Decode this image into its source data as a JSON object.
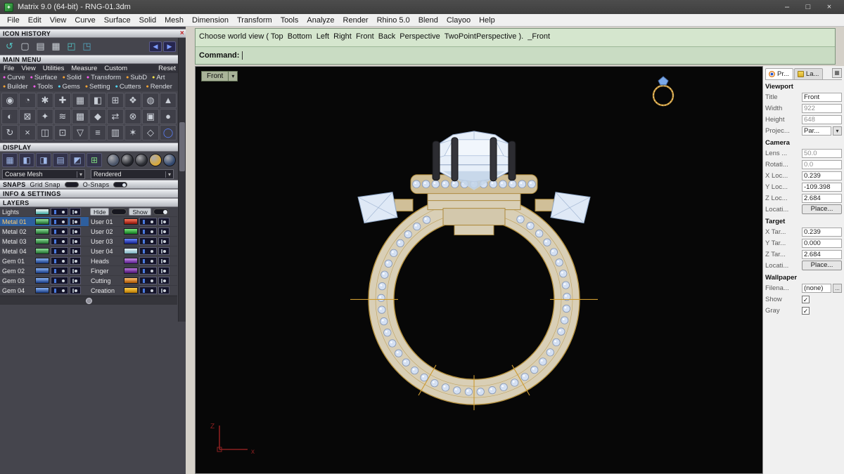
{
  "window": {
    "title": "Matrix 9.0 (64-bit) - RNG-01.3dm",
    "controls": {
      "minimize": "–",
      "maximize": "□",
      "close": "×"
    }
  },
  "icons": {
    "close_x": "×",
    "dropdown": "▾",
    "back": "◀",
    "forward": "▶",
    "check": "✓",
    "pin": "▦",
    "app": "✦"
  },
  "menubar": {
    "items": [
      "File",
      "Edit",
      "View",
      "Curve",
      "Surface",
      "Solid",
      "Mesh",
      "Dimension",
      "Transform",
      "Tools",
      "Analyze",
      "Render",
      "Rhino 5.0",
      "Blend",
      "Clayoo",
      "Help"
    ]
  },
  "command_area": {
    "history": "Choose world view ( Top  Bottom  Left  Right  Front  Back  Perspective  TwoPointPerspective ).  _Front",
    "prompt_label": "Command:"
  },
  "left_panel": {
    "icon_history": {
      "title": "ICON HISTORY",
      "icons": [
        {
          "n": "undo-history",
          "g": "↺",
          "c": "#53c2c2"
        },
        {
          "n": "new-file",
          "g": "▢"
        },
        {
          "n": "notes",
          "g": "▤"
        },
        {
          "n": "table",
          "g": "▦"
        },
        {
          "n": "open-folder",
          "g": "◰",
          "c": "#53c2c2"
        },
        {
          "n": "export",
          "g": "◳",
          "c": "#53a8c2"
        }
      ]
    },
    "main_menu": {
      "title": "MAIN MENU",
      "items": [
        "File",
        "View",
        "Utilities",
        "Measure",
        "Custom"
      ],
      "reset_label": "Reset",
      "categories_row1": [
        {
          "label": "Curve",
          "color": "#ff5ef2"
        },
        {
          "label": "Surface",
          "color": "#ff5ef2"
        },
        {
          "label": "Solid",
          "color": "#ffa733"
        },
        {
          "label": "Transform",
          "color": "#ff5ef2"
        },
        {
          "label": "SubD",
          "color": "#ffa733"
        },
        {
          "label": "Art",
          "color": "#ffe94a"
        }
      ],
      "categories_row2": [
        {
          "label": "Builder",
          "color": "#ffa733"
        },
        {
          "label": "Tools",
          "color": "#ff5ef2"
        },
        {
          "label": "Gems",
          "color": "#52dcff"
        },
        {
          "label": "Setting",
          "color": "#ffa733"
        },
        {
          "label": "Cutters",
          "color": "#52dcff"
        },
        {
          "label": "Render",
          "color": "#ffa733"
        }
      ]
    },
    "toolbar_rows": [
      [
        {
          "n": "pointer",
          "g": "◉"
        },
        {
          "n": "history",
          "g": "◔"
        },
        {
          "n": "points",
          "g": "✱"
        },
        {
          "n": "move",
          "g": "✚"
        },
        {
          "n": "grid",
          "g": "▦"
        },
        {
          "n": "split",
          "g": "◧"
        },
        {
          "n": "array",
          "g": "⊞"
        },
        {
          "n": "gem-tool",
          "g": "❖"
        },
        {
          "n": "sphere",
          "g": "◍"
        },
        {
          "n": "mesh",
          "g": "▲"
        }
      ],
      [
        {
          "n": "shade",
          "g": "◐"
        },
        {
          "n": "delete",
          "g": "⊠"
        },
        {
          "n": "sparkle",
          "g": "✦"
        },
        {
          "n": "waves",
          "g": "≋"
        },
        {
          "n": "hatch",
          "g": "▩"
        },
        {
          "n": "diamond",
          "g": "◆"
        },
        {
          "n": "swap",
          "g": "⇄"
        },
        {
          "n": "boolean",
          "g": "⊗"
        },
        {
          "n": "box",
          "g": "▣"
        },
        {
          "n": "dot",
          "g": "●"
        }
      ],
      [
        {
          "n": "rotate",
          "g": "↻"
        },
        {
          "n": "erase",
          "g": "×"
        },
        {
          "n": "panels",
          "g": "◫"
        },
        {
          "n": "center",
          "g": "⊡"
        },
        {
          "n": "taper",
          "g": "▽"
        },
        {
          "n": "layers-tool",
          "g": "≡"
        },
        {
          "n": "rows",
          "g": "▥"
        },
        {
          "n": "star",
          "g": "✶"
        },
        {
          "n": "gem",
          "g": "◇"
        },
        {
          "n": "ring-tool",
          "g": "◯",
          "c": "#5a7cf0"
        }
      ]
    ],
    "display": {
      "title": "DISPLAY",
      "icons": [
        {
          "n": "wire",
          "g": "▦"
        },
        {
          "n": "half-left",
          "g": "◧"
        },
        {
          "n": "half-right",
          "g": "◨"
        },
        {
          "n": "lines",
          "g": "▤"
        },
        {
          "n": "corner",
          "g": "◩"
        },
        {
          "n": "plus",
          "g": "⊞",
          "c": "#7ed87e"
        }
      ],
      "spheres": [
        "#4a5468",
        "#23252b",
        "#2b2d33",
        "#d8a93c",
        "#32486e"
      ],
      "mesh_dropdown": "Coarse Mesh",
      "render_dropdown": "Rendered"
    },
    "snaps": {
      "title": "SNAPS",
      "grid_snap_label": "Grid Snap",
      "osnaps_label": "O-Snaps"
    },
    "info": {
      "title": "INFO & SETTINGS"
    },
    "layers": {
      "title": "LAYERS",
      "hide_label": "Hide",
      "show_label": "Show",
      "left_rows": [
        {
          "name": "Lights",
          "c1": "#ffffff",
          "c2": "#3aa8a0",
          "selected": false
        },
        {
          "name": "Metal 01",
          "c1": "#8fe39a",
          "c2": "#1f6b2d",
          "selected": true
        },
        {
          "name": "Metal 02",
          "c1": "#8fe39a",
          "c2": "#1f6b2d",
          "selected": false
        },
        {
          "name": "Metal 03",
          "c1": "#8fe39a",
          "c2": "#1f6b2d",
          "selected": false
        },
        {
          "name": "Metal 04",
          "c1": "#8fe39a",
          "c2": "#1f6b2d",
          "selected": false
        },
        {
          "name": "Gem 01",
          "c1": "#8ab4f4",
          "c2": "#16377e",
          "selected": false
        },
        {
          "name": "Gem 02",
          "c1": "#8ab4f4",
          "c2": "#16377e",
          "selected": false
        },
        {
          "name": "Gem 03",
          "c1": "#8ab4f4",
          "c2": "#16377e",
          "selected": false
        },
        {
          "name": "Gem 04",
          "c1": "#8ab4f4",
          "c2": "#16377e",
          "selected": false
        }
      ],
      "right_rows": [
        {
          "name": "User 01",
          "c1": "#ff7a5e",
          "c2": "#8a1208"
        },
        {
          "name": "User 02",
          "c1": "#7ee87e",
          "c2": "#0f7a1f"
        },
        {
          "name": "User 03",
          "c1": "#6f8cff",
          "c2": "#101d8a"
        },
        {
          "name": "User 04",
          "c1": "#e8f6fa",
          "c2": "#7ab0c0"
        },
        {
          "name": "Heads",
          "c1": "#c890ec",
          "c2": "#551a86"
        },
        {
          "name": "Finger",
          "c1": "#bb7ae0",
          "c2": "#47106e"
        },
        {
          "name": "Cutting",
          "c1": "#ffc072",
          "c2": "#a85400"
        },
        {
          "name": "Creation",
          "c1": "#ffd24e",
          "c2": "#b87800"
        }
      ]
    }
  },
  "viewport": {
    "view_label": "Front",
    "axis": {
      "z": "Z",
      "x": "x"
    },
    "ring_colors": {
      "metal": "#d9cfb6",
      "gold": "#b5913f",
      "gold_bright": "#cd9a31",
      "stone": "#d4e0f2",
      "stone_edge": "#8496b6",
      "prong": "#2c2c31"
    }
  },
  "right_panel": {
    "tabs": [
      {
        "label": "Pr..."
      },
      {
        "label": "La..."
      }
    ],
    "groups": [
      {
        "header": "Viewport",
        "rows": [
          {
            "label": "Title",
            "value": "Front",
            "type": "text"
          },
          {
            "label": "Width",
            "value": "922",
            "type": "text",
            "dim": true
          },
          {
            "label": "Height",
            "value": "648",
            "type": "text",
            "dim": true
          },
          {
            "label": "Projec...",
            "value": "Par...",
            "type": "dropdown"
          }
        ]
      },
      {
        "header": "Camera",
        "rows": [
          {
            "label": "Lens ...",
            "value": "50.0",
            "type": "text",
            "dim": true
          },
          {
            "label": "Rotati...",
            "value": "0.0",
            "type": "text",
            "dim": true
          },
          {
            "label": "X Loc...",
            "value": "0.239",
            "type": "text"
          },
          {
            "label": "Y Loc...",
            "value": "-109.398",
            "type": "text"
          },
          {
            "label": "Z Loc...",
            "value": "2.684",
            "type": "text"
          },
          {
            "label": "Locati...",
            "value": "Place...",
            "type": "button"
          }
        ]
      },
      {
        "header": "Target",
        "rows": [
          {
            "label": "X Tar...",
            "value": "0.239",
            "type": "text"
          },
          {
            "label": "Y Tar...",
            "value": "0.000",
            "type": "text"
          },
          {
            "label": "Z Tar...",
            "value": "2.684",
            "type": "text"
          },
          {
            "label": "Locati...",
            "value": "Place...",
            "type": "button"
          }
        ]
      },
      {
        "header": "Wallpaper",
        "rows": [
          {
            "label": "Filena...",
            "value": "(none)",
            "type": "file"
          },
          {
            "label": "Show",
            "type": "checkbox",
            "checked": true
          },
          {
            "label": "Gray",
            "type": "checkbox",
            "checked": true
          }
        ]
      }
    ]
  }
}
